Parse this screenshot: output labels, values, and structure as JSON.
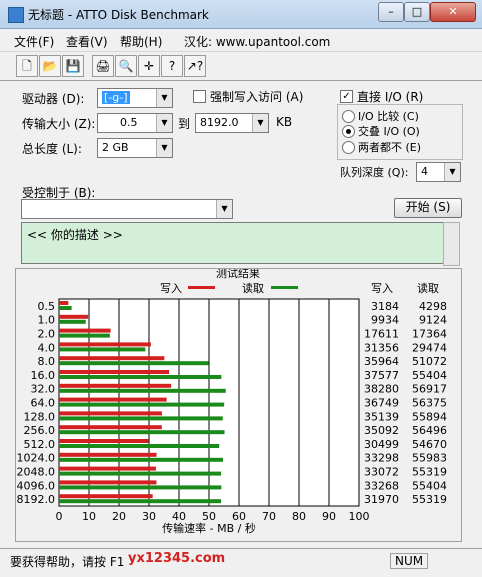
{
  "window": {
    "title": "无标题 - ATTO Disk Benchmark",
    "min_label": "–",
    "max_label": "□",
    "close_label": "✕"
  },
  "menu": [
    "文件(F)",
    "查看(V)",
    "帮助(H)",
    "汉化: www.upantool.com"
  ],
  "toolbar": [
    {
      "icon": "new-document-icon",
      "glyph": "🗋"
    },
    {
      "icon": "open-folder-icon",
      "glyph": "📂"
    },
    {
      "icon": "save-icon",
      "glyph": "💾"
    },
    {
      "icon": "print-icon",
      "glyph": "🖨"
    },
    {
      "icon": "print-preview-icon",
      "glyph": "🔍"
    },
    {
      "icon": "move-icon",
      "glyph": "✛"
    },
    {
      "icon": "help-icon",
      "glyph": "?"
    },
    {
      "icon": "context-help-icon",
      "glyph": "↗?"
    }
  ],
  "settings": {
    "drive_label": "驱动器 (D):",
    "drive_value": "[-g-]",
    "transfer_label": "传输大小 (Z):",
    "transfer_from": "0.5",
    "to_label": "到",
    "transfer_to": "8192.0",
    "kb_label": "KB",
    "length_label": "总长度 (L):",
    "length_value": "2 GB",
    "force_write_label": "强制写入访问 (A)",
    "direct_io_label": "直接 I/O (R)",
    "io_compare_label": "I/O 比较 (C)",
    "overlapped_io_label": "交叠 I/O (O)",
    "neither_label": "两者都不 (E)",
    "queue_label": "队列深度 (Q):",
    "queue_value": "4",
    "controlled_by_label": "受控制于 (B):",
    "controlled_by_value": "",
    "start_button": "开始 (S)",
    "description": "<<  你的描述  >>"
  },
  "results": {
    "title": "测试结果",
    "write_legend": "写入",
    "read_legend": "读取",
    "write_header": "写入",
    "read_header": "读取"
  },
  "chart_data": {
    "type": "bar",
    "orientation": "horizontal",
    "title": "测试结果",
    "xlabel": "传输速率 - MB / 秒",
    "xlim": [
      0,
      100
    ],
    "xticks": [
      "0",
      "10",
      "20",
      "30",
      "40",
      "50",
      "60",
      "70",
      "80",
      "90",
      "100"
    ],
    "categories": [
      "0.5",
      "1.0",
      "2.0",
      "4.0",
      "8.0",
      "16.0",
      "32.0",
      "64.0",
      "128.0",
      "256.0",
      "512.0",
      "1024.0",
      "2048.0",
      "4096.0",
      "8192.0"
    ],
    "series": [
      {
        "name": "写入",
        "color": "#d42020",
        "values": [
          3.11,
          9.7,
          17.2,
          30.62,
          35.12,
          36.7,
          37.38,
          35.89,
          34.31,
          34.27,
          29.78,
          32.52,
          32.3,
          32.49,
          31.22
        ],
        "labels": [
          "3184",
          "9934",
          "17611",
          "31356",
          "35964",
          "37577",
          "38280",
          "36749",
          "35139",
          "35092",
          "30499",
          "33298",
          "33072",
          "33268",
          "31970"
        ]
      },
      {
        "name": "读取",
        "color": "#1a8a1a",
        "values": [
          4.19,
          8.91,
          16.96,
          28.78,
          49.88,
          54.11,
          55.58,
          55.05,
          54.58,
          55.17,
          53.39,
          54.67,
          54.02,
          54.1,
          54.02
        ],
        "labels": [
          "4298",
          "9124",
          "17364",
          "29474",
          "51072",
          "55404",
          "56917",
          "56375",
          "55894",
          "56496",
          "54670",
          "55983",
          "55319",
          "55404",
          "55319"
        ]
      }
    ],
    "grid": true,
    "legend": "top"
  },
  "status": {
    "text": "要获得帮助，请按 F1",
    "watermark": "yx12345.com",
    "num": "NUM"
  }
}
